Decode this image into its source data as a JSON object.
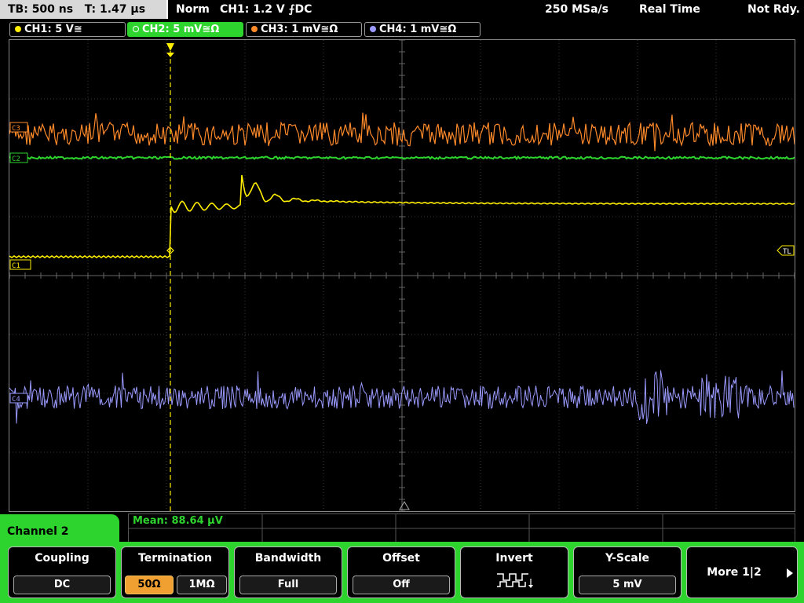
{
  "topbar": {
    "timebase": "TB: 500 ns",
    "trigger_time": "T: 1.47 µs",
    "trigger_mode": "Norm",
    "trigger_source": "CH1: 1.2 V ⨍DC",
    "sample_rate": "250 MSa/s",
    "acq_mode": "Real Time",
    "status": "Not Rdy."
  },
  "channels": [
    {
      "label": "CH1: 5 V≅",
      "color": "#ffee00"
    },
    {
      "label": "CH2: 5 mV≅Ω",
      "color": "#2ed42e"
    },
    {
      "label": "CH3: 1 mV≅Ω",
      "color": "#ff8a2a"
    },
    {
      "label": "CH4: 1 mV≅Ω",
      "color": "#9a9aff"
    }
  ],
  "markers": {
    "ch3": "C3",
    "ch2": "C2",
    "ch1": "C1",
    "ch4": "C4",
    "trigger_level": "TL"
  },
  "measurement": {
    "mean": "Mean: 88.64 µV"
  },
  "menu": {
    "title": "Channel 2",
    "coupling_label": "Coupling",
    "coupling_value": "DC",
    "termination_label": "Termination",
    "termination_50": "50Ω",
    "termination_1m": "1MΩ",
    "bandwidth_label": "Bandwidth",
    "bandwidth_value": "Full",
    "offset_label": "Offset",
    "offset_value": "Off",
    "invert_label": "Invert",
    "invert_icon": "invert-square-wave-icon",
    "yscale_label": "Y-Scale",
    "yscale_value": "5 mV",
    "more_label": "More 1|2"
  }
}
